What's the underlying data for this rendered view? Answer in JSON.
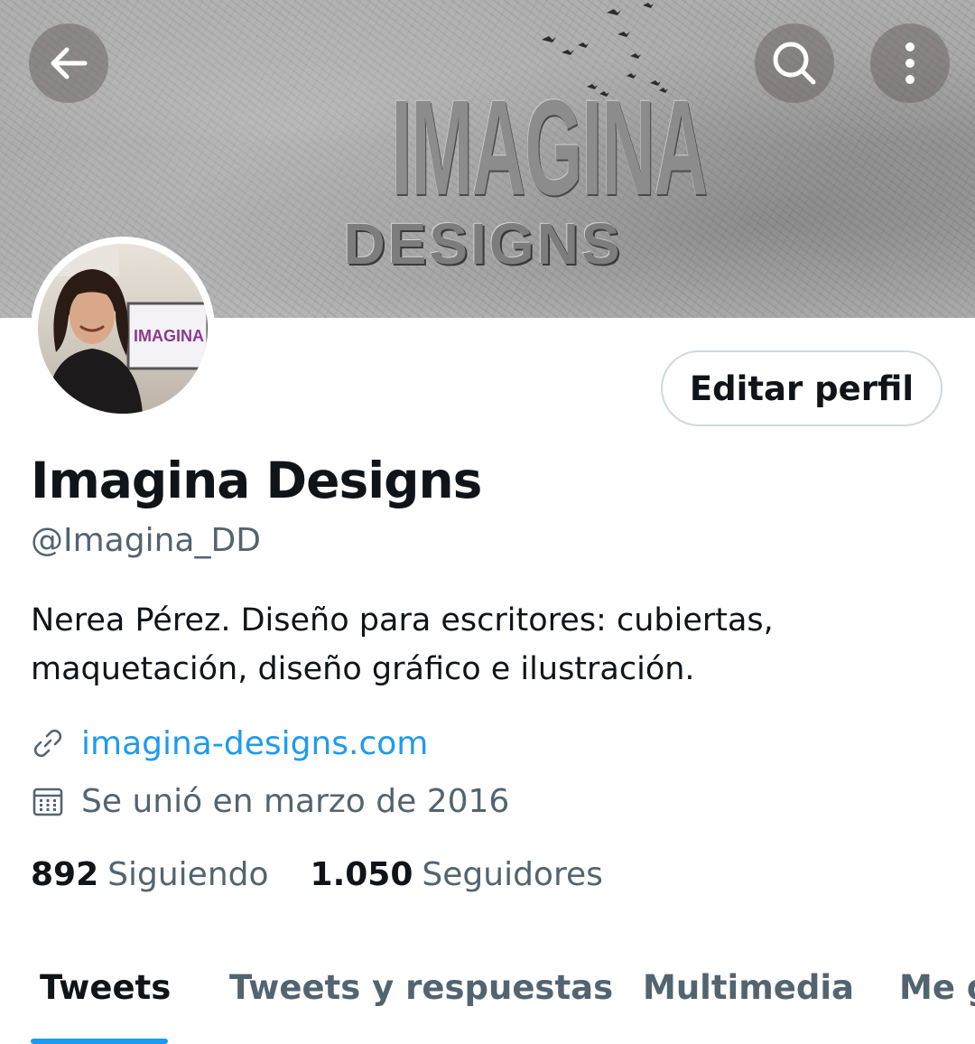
{
  "banner": {
    "logo_line1": "IMAGINA",
    "logo_line2": "DESIGNS"
  },
  "header_icons": {
    "back": "arrow-left-icon",
    "search": "search-icon",
    "more": "more-vertical-icon"
  },
  "avatar": {
    "screen_text": "IMAGINA"
  },
  "profile": {
    "edit_button": "Editar perfil",
    "name": "Imagina Designs",
    "handle": "@Imagina_DD",
    "bio": "Nerea Pérez.  Diseño para escritores: cubiertas, maquetación, diseño gráfico e ilustración.",
    "website": "imagina-designs.com",
    "joined": "Se unió en marzo de 2016"
  },
  "stats": {
    "following_count": "892",
    "following_label": "Siguiendo",
    "followers_count": "1.050",
    "followers_label": "Seguidores"
  },
  "tabs": [
    {
      "label": "Tweets",
      "active": true
    },
    {
      "label": "Tweets y respuestas",
      "active": false
    },
    {
      "label": "Multimedia",
      "active": false
    },
    {
      "label": "Me gusta",
      "active": false
    }
  ],
  "colors": {
    "accent": "#1d9bf0",
    "text_primary": "#0f1419",
    "text_secondary": "#536471",
    "border": "#cfd9de"
  }
}
